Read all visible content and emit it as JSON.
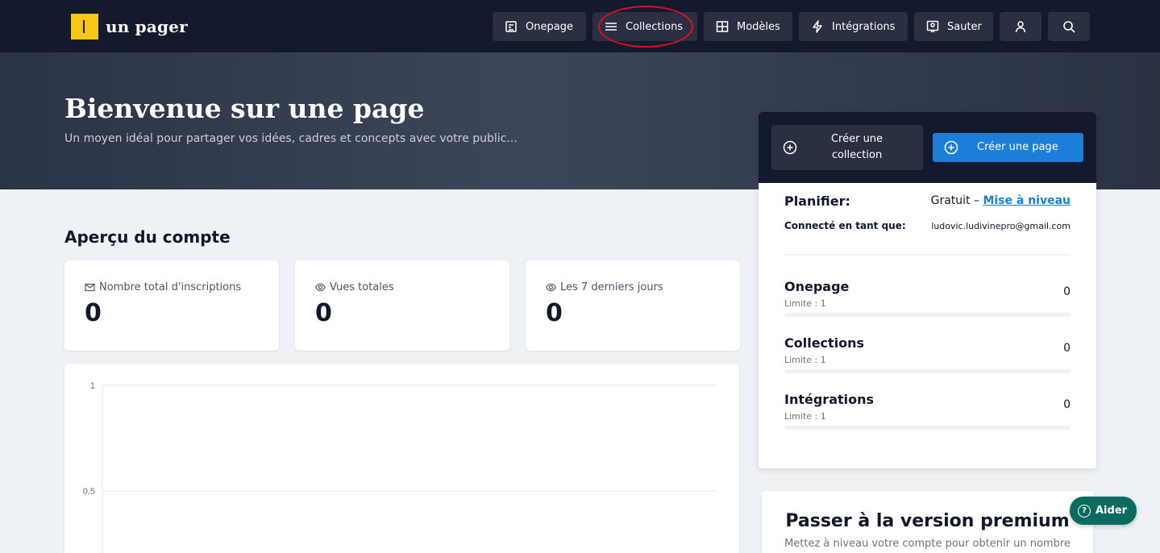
{
  "brand": {
    "name": "un pager",
    "accent": "#f7c713"
  },
  "nav": {
    "items": [
      {
        "label": "Onepage",
        "icon": "document-icon"
      },
      {
        "label": "Collections",
        "icon": "menu-icon"
      },
      {
        "label": "Modèles",
        "icon": "layout-icon"
      },
      {
        "label": "Intégrations",
        "icon": "bolt-icon"
      },
      {
        "label": "Sauter",
        "icon": "map-pin-icon"
      }
    ],
    "account_icon": "user-icon",
    "search_icon": "search-icon"
  },
  "hero": {
    "title": "Bienvenue sur une page",
    "subtitle": "Un moyen idéal pour partager vos idées, cadres et concepts avec votre public..."
  },
  "overview": {
    "title": "Aperçu du compte",
    "stats": [
      {
        "label": "Nombre total d'inscriptions",
        "value": "0",
        "icon": "mail-icon"
      },
      {
        "label": "Vues totales",
        "value": "0",
        "icon": "eye-icon"
      },
      {
        "label": "Les 7 derniers jours",
        "value": "0",
        "icon": "eye-icon"
      }
    ]
  },
  "chart": {
    "y_ticks": [
      "1",
      "0.5"
    ]
  },
  "panel": {
    "create_collection": "Créer une collection",
    "create_page": "Créer une page",
    "plan_label": "Planifier:",
    "plan_value": "Gratuit – ",
    "upgrade_link": "Mise à niveau",
    "connected_label": "Connecté en tant que:",
    "connected_email": "ludovic.ludivinepro@gmail.com",
    "usage": [
      {
        "name": "Onepage",
        "limit": "Limite : 1",
        "count": "0",
        "fill": 0
      },
      {
        "name": "Collections",
        "limit": "Limite : 1",
        "count": "0",
        "fill": 0
      },
      {
        "name": "Intégrations",
        "limit": "Limite : 1",
        "count": "0",
        "fill": 0
      }
    ]
  },
  "premium": {
    "title": "Passer à la version premium",
    "subtitle": "Mettez à niveau votre compte pour obtenir un nombre"
  },
  "help": {
    "label": "Aider"
  },
  "colors": {
    "nav_bg": "#141a2e",
    "button_bg": "#2a3041",
    "primary": "#1b7ed9",
    "help_bg": "#0b6b5f",
    "highlight": "#d4141c"
  }
}
